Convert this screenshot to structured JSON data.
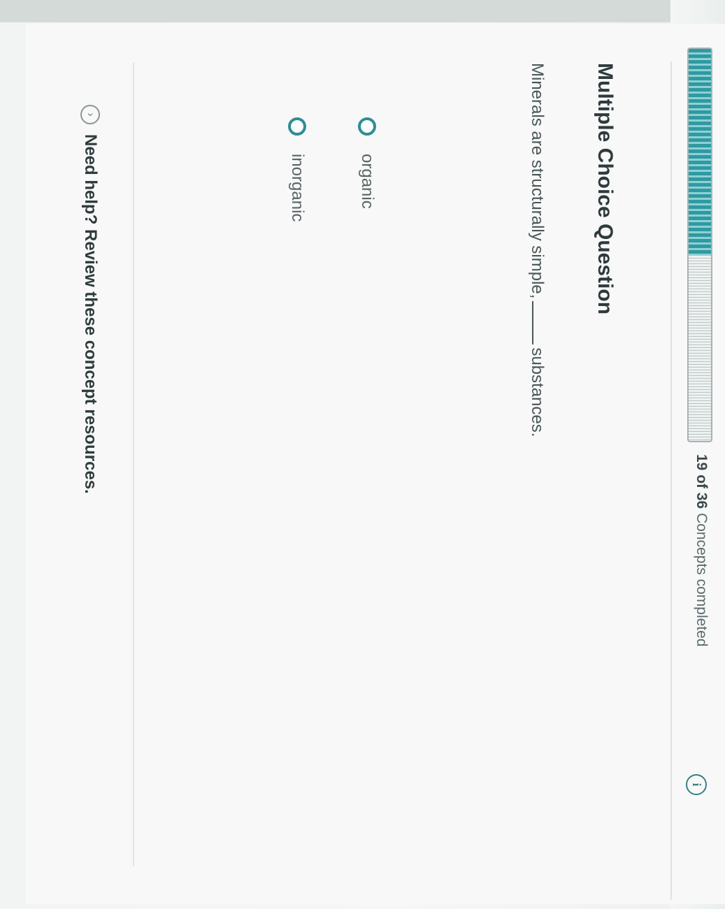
{
  "progress": {
    "completed": 19,
    "total": 36,
    "count_prefix": "19 of 36",
    "label": "Concepts completed",
    "fraction": 0.528
  },
  "info_icon": {
    "glyph": "i",
    "icon": "info-icon"
  },
  "question": {
    "type_title": "Multiple Choice Question",
    "stem_before": "Minerals are structurally simple,",
    "stem_after": "substances."
  },
  "options": [
    {
      "label": "organic",
      "selected": false
    },
    {
      "label": "inorganic",
      "selected": false
    }
  ],
  "help": {
    "icon": "expand-icon",
    "glyph": "›",
    "text": "Need help? Review these concept resources."
  },
  "colors": {
    "accent": "#2f8d94",
    "progress_fill": "#2e9aa2",
    "text_dark": "#2e3a3c"
  }
}
